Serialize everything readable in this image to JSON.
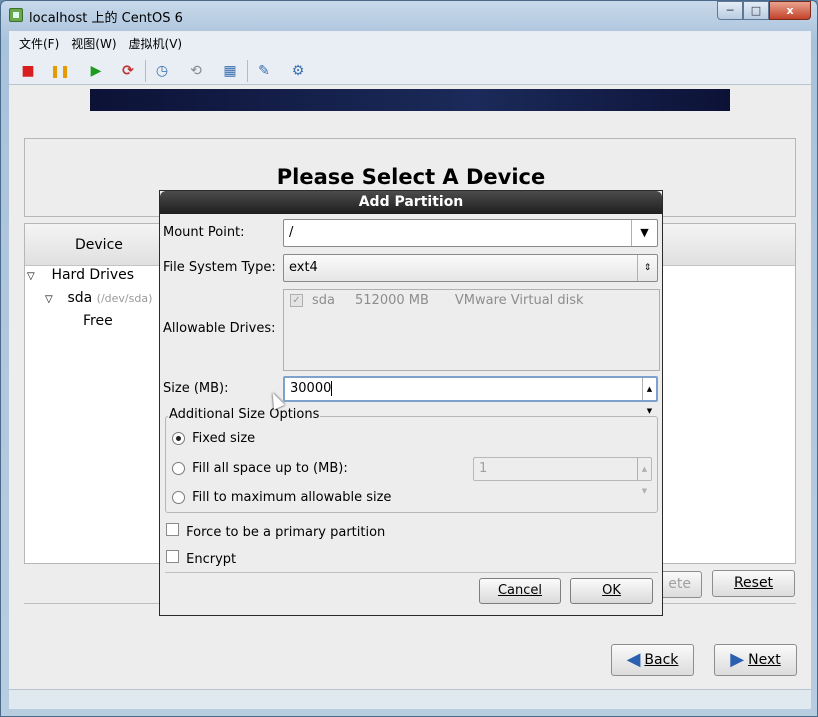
{
  "window": {
    "title": "localhost 上的 CentOS 6",
    "controls": {
      "minimize": "─",
      "maximize": "□",
      "close": "x"
    }
  },
  "menubar": {
    "items": [
      {
        "label": "文件(F)"
      },
      {
        "label": "视图(W)"
      },
      {
        "label": "虚拟机(V)"
      }
    ]
  },
  "toolbar": {
    "icons": [
      "stop-icon",
      "pause-icon",
      "play-icon",
      "refresh-icon",
      "snapshot-icon",
      "snapshot-revert-icon",
      "snapshot-manager-icon",
      "edit-vm-icon",
      "settings-icon"
    ],
    "glyphs": {
      "stop": "■",
      "pause": "❚❚",
      "play": "▶",
      "refresh": "⟳",
      "snapshot": "◷",
      "revert": "⟲",
      "manager": "▦",
      "edit": "✎",
      "settings": "⚙"
    },
    "colors": {
      "stop": "#d81e1e",
      "pause": "#e59a00",
      "play": "#1e9a1e",
      "refresh": "#c03030",
      "other": "#3c6fb0"
    }
  },
  "installer": {
    "heading": "Please Select A Device",
    "tree": {
      "column": "Device",
      "hard_drives": "Hard Drives",
      "sda": "sda",
      "sda_path": "(/dev/sda)",
      "free": "Free"
    },
    "delete_fragment": "ete",
    "reset_label": "Reset",
    "back_label": "Back",
    "next_label": "Next"
  },
  "dialog": {
    "title": "Add Partition",
    "mount_point_label": "Mount Point:",
    "mount_point_value": "/",
    "fs_type_label": "File System Type:",
    "fs_type_value": "ext4",
    "allowable_drives_label": "Allowable Drives:",
    "drive": {
      "name": "sda",
      "size": "512000 MB",
      "model": "VMware Virtual disk",
      "checked": true
    },
    "size_label": "Size (MB):",
    "size_value": "30000",
    "additional_title": "Additional Size Options",
    "options": [
      {
        "label": "Fixed size",
        "selected": true
      },
      {
        "label": "Fill all space up to (MB):",
        "selected": false
      },
      {
        "label": "Fill to maximum allowable size",
        "selected": false
      }
    ],
    "fill_up_to_value": "1",
    "primary_label": "Force to be a primary partition",
    "encrypt_label": "Encrypt",
    "cancel_label": "Cancel",
    "ok_label": "OK"
  }
}
